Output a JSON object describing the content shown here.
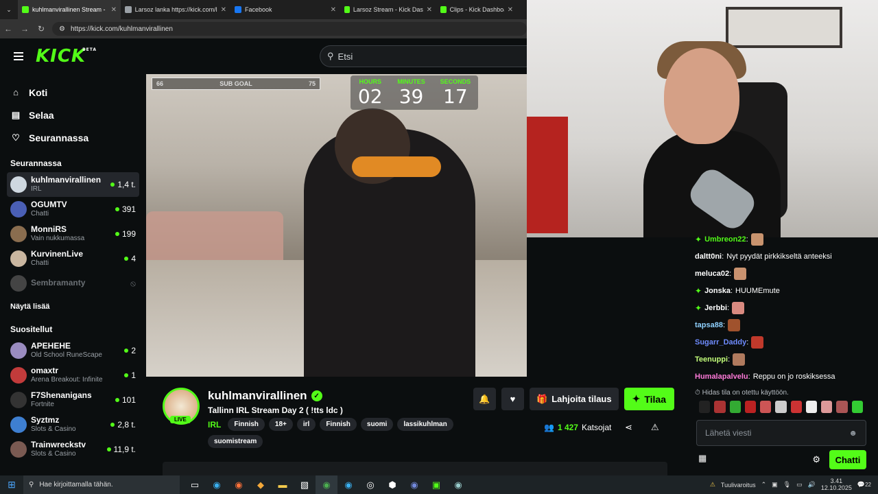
{
  "browser": {
    "tabs": [
      {
        "title": "kuhlmanvirallinen Stream -",
        "color": "#53fc18",
        "active": true
      },
      {
        "title": "Larsoz lanka https://kick.com/la",
        "color": "#9aa0a6",
        "active": false
      },
      {
        "title": "Facebook",
        "color": "#1877f2",
        "active": false
      },
      {
        "title": "Larsoz Stream - Kick Dashboard",
        "color": "#53fc18",
        "active": false
      },
      {
        "title": "Clips - Kick Dashboard",
        "color": "#53fc18",
        "active": false
      }
    ],
    "url": "https://kick.com/kuhlmanvirallinen"
  },
  "header": {
    "logo": "KICK",
    "beta": "BETA",
    "search_placeholder": "Etsi"
  },
  "sidebar": {
    "nav": [
      {
        "label": "Koti",
        "icon": "home-icon"
      },
      {
        "label": "Selaa",
        "icon": "browse-icon"
      },
      {
        "label": "Seurannassa",
        "icon": "heart-icon"
      }
    ],
    "following_title": "Seurannassa",
    "following": [
      {
        "name": "kuhlmanvirallinen",
        "sub": "IRL",
        "count": "1,4 t.",
        "color": "#cfd8e0"
      },
      {
        "name": "OGUMTV",
        "sub": "Chatti",
        "count": "391",
        "color": "#4a5fb5"
      },
      {
        "name": "MonniRS",
        "sub": "Vain nukkumassa",
        "count": "199",
        "color": "#8a6d4f"
      },
      {
        "name": "KurvinenLive",
        "sub": "Chatti",
        "count": "4",
        "color": "#c9b6a0"
      },
      {
        "name": "Sembramanty",
        "sub": "",
        "count": "",
        "color": "#444"
      }
    ],
    "show_more": "Näytä lisää",
    "recommended_title": "Suositellut",
    "recommended": [
      {
        "name": "APEHEHE",
        "sub": "Old School RuneScape",
        "count": "2",
        "color": "#9a8cc0"
      },
      {
        "name": "omaxtr",
        "sub": "Arena Breakout: Infinite",
        "count": "1",
        "color": "#c23b3b"
      },
      {
        "name": "F7Shenanigans",
        "sub": "Fortnite",
        "count": "101",
        "color": "#333"
      },
      {
        "name": "Syztmz",
        "sub": "Slots & Casino",
        "count": "2,8 t.",
        "color": "#3e7fd1"
      },
      {
        "name": "Trainwreckstv",
        "sub": "Slots & Casino",
        "count": "11,9 t.",
        "color": "#7a5a52"
      }
    ]
  },
  "overlay": {
    "subgoal_left": "66",
    "subgoal_label": "SUB GOAL",
    "subgoal_right": "75",
    "timer": [
      {
        "label": "HOURS",
        "value": "02"
      },
      {
        "label": "MINUTES",
        "value": "39"
      },
      {
        "label": "SECONDS",
        "value": "17"
      }
    ]
  },
  "stream": {
    "streamer": "kuhlmanvirallinen",
    "live": "LIVE",
    "title": "Tallinn IRL Stream Day 2 ( !tts ldc )",
    "category": "IRL",
    "tags": [
      "Finnish",
      "18+",
      "irl",
      "Finnish",
      "suomi",
      "lassikuhlman",
      "suomistream"
    ],
    "gift_label": "Lahjoita tilaus",
    "subscribe_label": "Tilaa",
    "viewers": "1 427",
    "viewers_label": "Katsojat"
  },
  "chat": {
    "messages": [
      {
        "user": "Umbreon22",
        "text": "",
        "color": "#53fc18",
        "badge": true,
        "emote": "#c8936e"
      },
      {
        "user": "daltt0ni",
        "text": "Nyt pyydät pirkkikseltä anteeksi",
        "color": "#ffffff",
        "badge": false,
        "emote": ""
      },
      {
        "user": "meluca02",
        "text": "",
        "color": "#ffffff",
        "badge": false,
        "emote": "#c9926f"
      },
      {
        "user": "Jonska",
        "text": "HUUMEmute",
        "color": "#ffffff",
        "badge": true,
        "emote": ""
      },
      {
        "user": "Jerbbi",
        "text": "",
        "color": "#ffffff",
        "badge": true,
        "emote": "#d98a80"
      },
      {
        "user": "tapsa88",
        "text": "",
        "color": "#8fd1ff",
        "badge": false,
        "emote": "#a0522d"
      },
      {
        "user": "Sugarr_Daddy",
        "text": "",
        "color": "#6f8cff",
        "badge": false,
        "emote": "#c0392b"
      },
      {
        "user": "Teenuppi",
        "text": "",
        "color": "#c3ff7a",
        "badge": false,
        "emote": "#b07a5e"
      },
      {
        "user": "Humalapalvelu",
        "text": "Reppu on jo roskiksessa",
        "color": "#ff7ad9",
        "badge": false,
        "emote": ""
      }
    ],
    "slow_mode": "Hidas tila on otettu käyttöön.",
    "emote_colors": [
      "#222",
      "#a33",
      "#3a3",
      "#b22",
      "#c55",
      "#ccc",
      "#c33",
      "#eee",
      "#d99",
      "#a55",
      "#3c3"
    ],
    "input_placeholder": "Lähetä viesti",
    "chat_button": "Chatti"
  },
  "taskbar": {
    "search_placeholder": "Hae kirjoittamalla tähän.",
    "weather": "Tuulivaroitus",
    "time": "3.41",
    "date": "12.10.2025",
    "notifications": "22"
  }
}
